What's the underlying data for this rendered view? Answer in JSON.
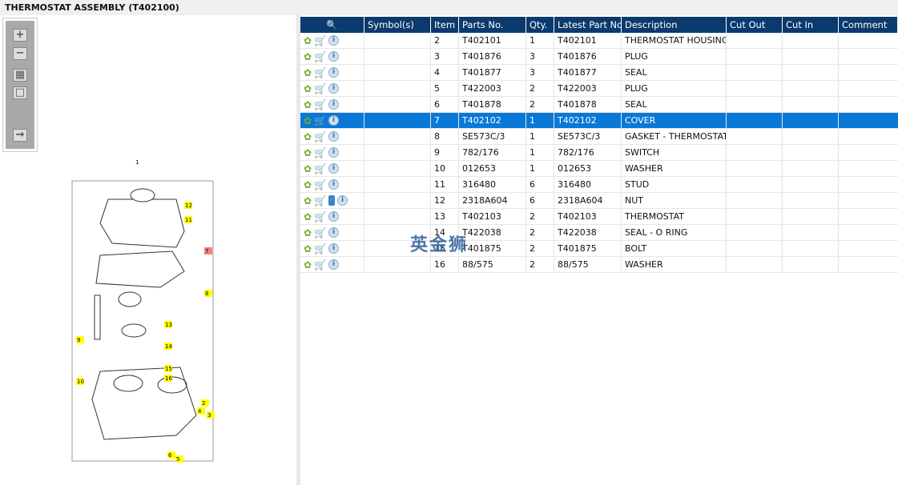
{
  "title": "THERMOSTAT ASSEMBLY (T402100)",
  "toolbox": {
    "zoom_in": "zoom-in",
    "zoom_out": "zoom-out",
    "fit": "fit",
    "actual": "actual",
    "export": "export"
  },
  "drawing": {
    "top_label": "1",
    "callouts": [
      "12",
      "11",
      "7",
      "8",
      "13",
      "9",
      "14",
      "15",
      "16",
      "10",
      "2",
      "4",
      "3",
      "6",
      "5"
    ]
  },
  "table": {
    "headers": [
      "",
      "Symbol(s)",
      "Item",
      "Parts No.",
      "Qty.",
      "Latest Part No.",
      "Description",
      "Cut Out",
      "Cut In",
      "Comment"
    ],
    "rows": [
      {
        "item": "2",
        "part": "T402101",
        "qty": "1",
        "latest": "T402101",
        "desc": "THERMOSTAT HOUSING"
      },
      {
        "item": "3",
        "part": "T401876",
        "qty": "3",
        "latest": "T401876",
        "desc": "PLUG"
      },
      {
        "item": "4",
        "part": "T401877",
        "qty": "3",
        "latest": "T401877",
        "desc": "SEAL"
      },
      {
        "item": "5",
        "part": "T422003",
        "qty": "2",
        "latest": "T422003",
        "desc": "PLUG"
      },
      {
        "item": "6",
        "part": "T401878",
        "qty": "2",
        "latest": "T401878",
        "desc": "SEAL"
      },
      {
        "item": "7",
        "part": "T402102",
        "qty": "1",
        "latest": "T402102",
        "desc": "COVER",
        "selected": true
      },
      {
        "item": "8",
        "part": "SE573C/3",
        "qty": "1",
        "latest": "SE573C/3",
        "desc": "GASKET - THERMOSTAT H"
      },
      {
        "item": "9",
        "part": "782/176",
        "qty": "1",
        "latest": "782/176",
        "desc": "SWITCH"
      },
      {
        "item": "10",
        "part": "012653",
        "qty": "1",
        "latest": "012653",
        "desc": "WASHER"
      },
      {
        "item": "11",
        "part": "316480",
        "qty": "6",
        "latest": "316480",
        "desc": "STUD"
      },
      {
        "item": "12",
        "part": "2318A604",
        "qty": "6",
        "latest": "2318A604",
        "desc": "NUT",
        "book": true
      },
      {
        "item": "13",
        "part": "T402103",
        "qty": "2",
        "latest": "T402103",
        "desc": "THERMOSTAT"
      },
      {
        "item": "14",
        "part": "T422038",
        "qty": "2",
        "latest": "T422038",
        "desc": "SEAL - O RING"
      },
      {
        "item": "15",
        "part": "T401875",
        "qty": "2",
        "latest": "T401875",
        "desc": "BOLT"
      },
      {
        "item": "16",
        "part": "88/575",
        "qty": "2",
        "latest": "88/575",
        "desc": "WASHER"
      }
    ]
  },
  "watermark": "英金狮"
}
